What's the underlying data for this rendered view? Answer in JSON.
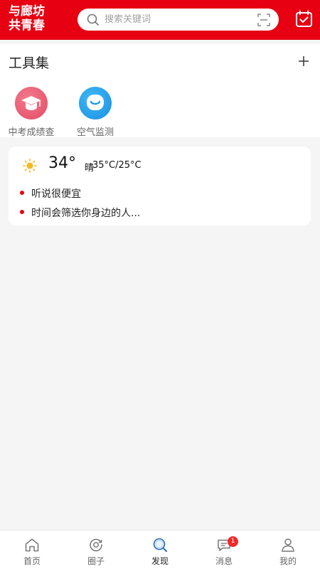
{
  "header": {
    "logo_line1": "与廊坊",
    "logo_line2": "共青春",
    "search_placeholder": "搜索关键词"
  },
  "tools": {
    "title": "工具集",
    "items": [
      {
        "label": "中考成绩查",
        "icon": "graduation-cap-icon",
        "color": "#e8506a"
      },
      {
        "label": "空气监测",
        "icon": "smile-icon",
        "color": "#1d9be9"
      }
    ]
  },
  "weather": {
    "temperature": "34°",
    "condition": "晴",
    "range": "35°C/25°C",
    "news": [
      "听说很便宜",
      "时间会筛选你身边的人..."
    ]
  },
  "tabbar": {
    "items": [
      {
        "label": "首页",
        "icon": "home-icon"
      },
      {
        "label": "圈子",
        "icon": "circle-icon"
      },
      {
        "label": "发现",
        "icon": "discover-icon",
        "active": true
      },
      {
        "label": "消息",
        "icon": "message-icon",
        "badge": "1"
      },
      {
        "label": "我的",
        "icon": "profile-icon"
      }
    ]
  },
  "colors": {
    "brand": "#e60012",
    "background": "#f5f5f5"
  }
}
